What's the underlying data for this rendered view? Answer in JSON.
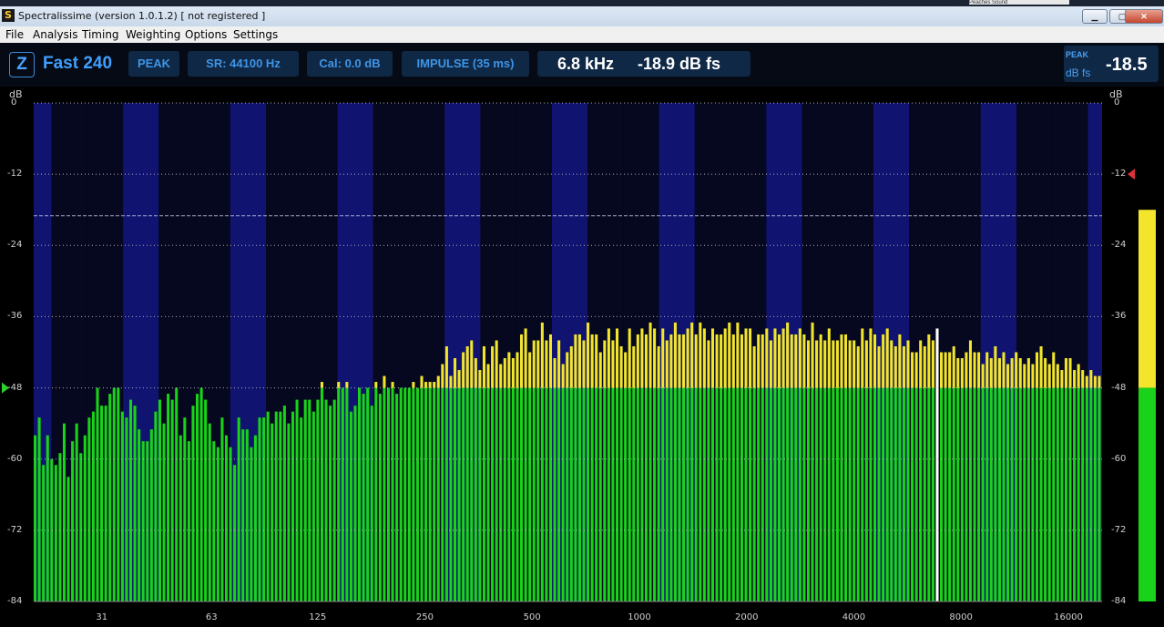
{
  "window": {
    "title": "Spectralissime (version 1.0.1.2) [ not registered ]",
    "app_icon_glyph": "S",
    "top_strip_text": "Peaches Sound",
    "minimize_glyph": "▁",
    "maximize_glyph": "▢",
    "close_glyph": "✕"
  },
  "menu": [
    "File",
    "Analysis",
    "Timing",
    "Weighting",
    "Options",
    "Settings"
  ],
  "toolbar": {
    "z_button": "Z",
    "mode": "Fast 240",
    "detector": "PEAK",
    "sample_rate": "SR: 44100 Hz",
    "calibration": "Cal:  0.0 dB",
    "impulse": "IMPULSE (35 ms)",
    "cursor_frequency": "6.8 kHz",
    "cursor_level": "-18.9 dB fs",
    "peak_label": "PEAK",
    "peak_unit": "dB fs",
    "peak_value": "-18.5"
  },
  "chart_data": {
    "type": "bar",
    "y_unit_left": "dB",
    "y_unit_right": "dB",
    "y_ticks": [
      "0",
      "-12",
      "-24",
      "-36",
      "-48",
      "-60",
      "-72",
      "-84"
    ],
    "ylim": [
      -84,
      0
    ],
    "x_ticks": [
      "31",
      "63",
      "125",
      "250",
      "500",
      "1000",
      "2000",
      "4000",
      "8000",
      "16000"
    ],
    "x_scale": "log",
    "xlim_hz": [
      20,
      20000
    ],
    "threshold_db": -48,
    "reference_line_db": -19,
    "peak_marker_db": -12,
    "level_marker_db": -48,
    "peak_meter_db": -18.5,
    "highlight_frequency_hz": 6800,
    "colors": {
      "below_threshold": "#19d219",
      "above_threshold": "#f2e52c",
      "band_light": "#101470",
      "band_dark": "#05081f",
      "highlight": "#ffffff"
    },
    "values": [
      -56,
      -53,
      -61,
      -56,
      -60,
      -61,
      -59,
      -54,
      -63,
      -57,
      -54,
      -59,
      -56,
      -53,
      -52,
      -48,
      -51,
      -51,
      -49,
      -48,
      -48,
      -52,
      -53,
      -50,
      -51,
      -55,
      -57,
      -57,
      -55,
      -52,
      -50,
      -54,
      -49,
      -50,
      -48,
      -56,
      -53,
      -57,
      -51,
      -49,
      -48,
      -50,
      -54,
      -57,
      -58,
      -53,
      -56,
      -58,
      -61,
      -53,
      -55,
      -55,
      -58,
      -56,
      -53,
      -53,
      -52,
      -54,
      -52,
      -52,
      -51,
      -54,
      -52,
      -50,
      -53,
      -50,
      -50,
      -52,
      -50,
      -47,
      -50,
      -51,
      -50,
      -47,
      -48,
      -47,
      -52,
      -51,
      -48,
      -49,
      -48,
      -51,
      -47,
      -49,
      -46,
      -48,
      -47,
      -49,
      -48,
      -48,
      -48,
      -47,
      -48,
      -46,
      -47,
      -47,
      -47,
      -46,
      -44,
      -41,
      -46,
      -43,
      -45,
      -42,
      -41,
      -40,
      -43,
      -45,
      -41,
      -44,
      -41,
      -40,
      -44,
      -43,
      -42,
      -43,
      -42,
      -39,
      -38,
      -42,
      -40,
      -40,
      -37,
      -40,
      -39,
      -43,
      -40,
      -44,
      -42,
      -41,
      -39,
      -39,
      -40,
      -37,
      -39,
      -39,
      -42,
      -40,
      -38,
      -40,
      -38,
      -41,
      -42,
      -38,
      -41,
      -39,
      -38,
      -39,
      -37,
      -38,
      -41,
      -38,
      -40,
      -39,
      -37,
      -39,
      -39,
      -38,
      -37,
      -39,
      -37,
      -38,
      -40,
      -38,
      -39,
      -39,
      -38,
      -37,
      -39,
      -37,
      -39,
      -38,
      -38,
      -41,
      -39,
      -39,
      -38,
      -40,
      -38,
      -39,
      -38,
      -37,
      -39,
      -39,
      -38,
      -39,
      -40,
      -37,
      -40,
      -39,
      -40,
      -38,
      -40,
      -40,
      -39,
      -39,
      -40,
      -40,
      -41,
      -38,
      -40,
      -38,
      -39,
      -41,
      -39,
      -38,
      -40,
      -41,
      -39,
      -41,
      -40,
      -42,
      -42,
      -40,
      -41,
      -39,
      -40,
      -43,
      -42,
      -42,
      -42,
      -41,
      -43,
      -43,
      -42,
      -40,
      -42,
      -42,
      -44,
      -42,
      -43,
      -41,
      -43,
      -42,
      -44,
      -43,
      -42,
      -43,
      -44,
      -43,
      -44,
      -42,
      -41,
      -43,
      -44,
      -42,
      -44,
      -45,
      -43,
      -43,
      -45,
      -44,
      -45,
      -46,
      -45,
      -46,
      -46
    ]
  }
}
